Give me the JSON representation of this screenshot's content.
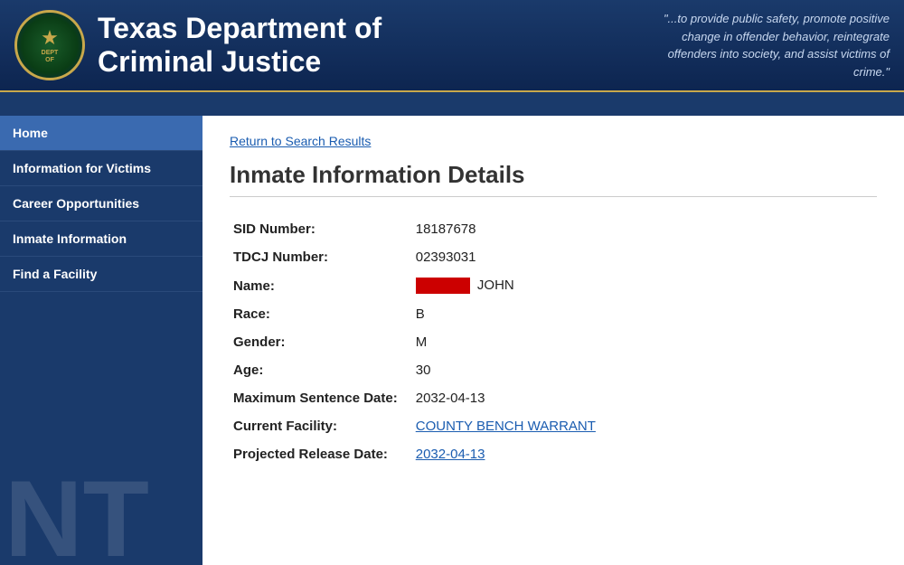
{
  "header": {
    "title_line1": "Texas Department of",
    "title_line2": "Criminal Justice",
    "quote": "\"...to provide public safety, promote positive change in offender behavior, reintegrate offenders into society, and assist victims of crime.\"",
    "logo_text": "DEPARTMENT",
    "logo_star": "★"
  },
  "sidebar": {
    "items": [
      {
        "id": "home",
        "label": "Home",
        "active": false
      },
      {
        "id": "information-for-victims",
        "label": "Information for Victims",
        "active": false
      },
      {
        "id": "career-opportunities",
        "label": "Career Opportunities",
        "active": false
      },
      {
        "id": "inmate-information",
        "label": "Inmate Information",
        "active": false
      },
      {
        "id": "find-a-facility",
        "label": "Find a Facility",
        "active": false
      }
    ],
    "watermark": "NT"
  },
  "main": {
    "back_link": "Return to Search Results",
    "page_title": "Inmate Information Details",
    "fields": [
      {
        "label": "SID Number:",
        "value": "18187678",
        "type": "text"
      },
      {
        "label": "TDCJ Number:",
        "value": "02393031",
        "type": "text"
      },
      {
        "label": "Name:",
        "value": "JOHN",
        "type": "name_redacted"
      },
      {
        "label": "Race:",
        "value": "B",
        "type": "text"
      },
      {
        "label": "Gender:",
        "value": "M",
        "type": "text"
      },
      {
        "label": "Age:",
        "value": "30",
        "type": "text"
      },
      {
        "label": "Maximum Sentence Date:",
        "value": "2032-04-13",
        "type": "text"
      },
      {
        "label": "Current Facility:",
        "value": "COUNTY BENCH WARRANT",
        "type": "link"
      },
      {
        "label": "Projected Release Date:",
        "value": "2032-04-13",
        "type": "link"
      }
    ]
  }
}
